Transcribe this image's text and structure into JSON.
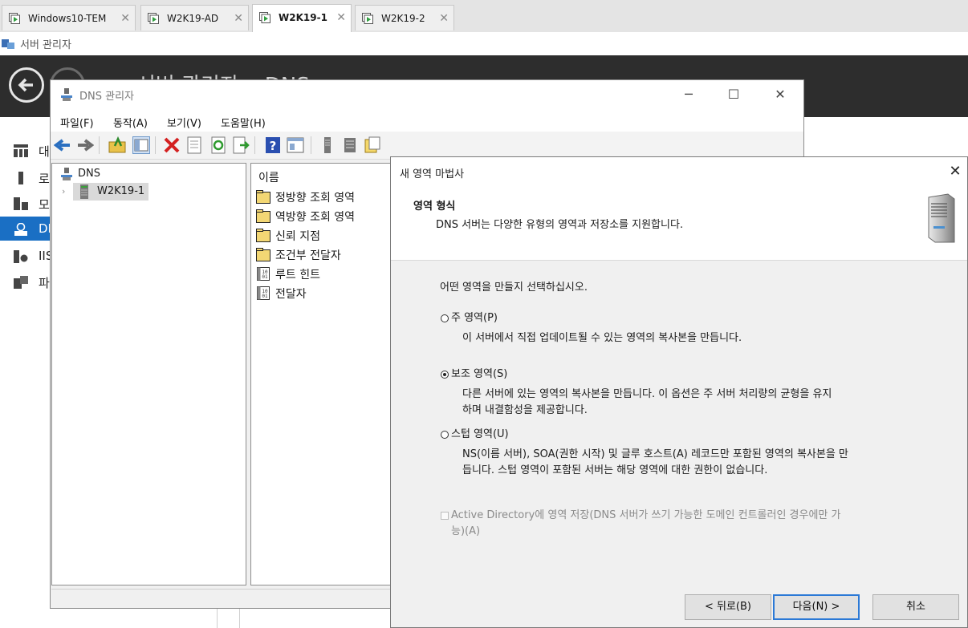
{
  "vm_tabs": [
    {
      "label": "Windows10-TEM",
      "active": false
    },
    {
      "label": "W2K19-AD",
      "active": false
    },
    {
      "label": "W2K19-1",
      "active": true
    },
    {
      "label": "W2K19-2",
      "active": false
    }
  ],
  "server_manager": {
    "title": "서버 관리자",
    "header_title": "서버 관리자 • DNS",
    "nav": [
      {
        "label": "대",
        "icon": "dashboard-icon"
      },
      {
        "label": "로",
        "icon": "local-server-icon"
      },
      {
        "label": "모",
        "icon": "all-servers-icon"
      },
      {
        "label": "DI",
        "icon": "dns-icon",
        "selected": true
      },
      {
        "label": "IIS",
        "icon": "iis-icon"
      },
      {
        "label": "파",
        "icon": "file-services-icon"
      }
    ]
  },
  "dns_manager": {
    "title": "DNS 관리자",
    "menu": [
      "파일(F)",
      "동작(A)",
      "보기(V)",
      "도움말(H)"
    ],
    "tree_root": "DNS",
    "tree_server": "W2K19-1",
    "list_header": "이름",
    "list_items": [
      {
        "label": "정방향 조회 영역",
        "icon": "folder-icon"
      },
      {
        "label": "역방향 조회 영역",
        "icon": "folder-icon"
      },
      {
        "label": "신뢰 지점",
        "icon": "folder-icon"
      },
      {
        "label": "조건부 전달자",
        "icon": "folder-icon"
      },
      {
        "label": "루트 힌트",
        "icon": "data-file-icon"
      },
      {
        "label": "전달자",
        "icon": "data-file-icon"
      }
    ]
  },
  "wizard": {
    "title": "새 영역 마법사",
    "heading": "영역 형식",
    "subheading": "DNS 서버는 다양한 유형의 영역과 저장소를 지원합니다.",
    "prompt": "어떤 영역을 만들지 선택하십시오.",
    "options": [
      {
        "label": "주 영역(P)",
        "selected": false,
        "desc": [
          "이 서버에서 직접 업데이트될 수 있는 영역의 복사본을 만듭니다."
        ]
      },
      {
        "label": "보조 영역(S)",
        "selected": true,
        "desc": [
          "다른 서버에 있는 영역의 복사본을 만듭니다. 이 옵션은 주 서버 처리량의 균형을 유지",
          "하며 내결함성을 제공합니다."
        ]
      },
      {
        "label": "스텁 영역(U)",
        "selected": false,
        "desc": [
          "NS(이름 서버), SOA(권한 시작) 및 글루 호스트(A) 레코드만 포함된 영역의 복사본을 만",
          "듭니다. 스텁 영역이 포함된 서버는 해당 영역에 대한 권한이 없습니다."
        ]
      }
    ],
    "ad_checkbox": {
      "lines": [
        "Active Directory에 영역 저장(DNS 서버가 쓰기 가능한 도메인 컨트롤러인 경우에만 가",
        "능)(A)"
      ],
      "checked": false,
      "enabled": false
    },
    "buttons": {
      "back": "< 뒤로(B)",
      "next": "다음(N) >",
      "cancel": "취소"
    }
  },
  "colors": {
    "nav_selected": "#1a6fc4",
    "header_dark": "#2d2d2d",
    "default_button_border": "#2b79d6"
  }
}
